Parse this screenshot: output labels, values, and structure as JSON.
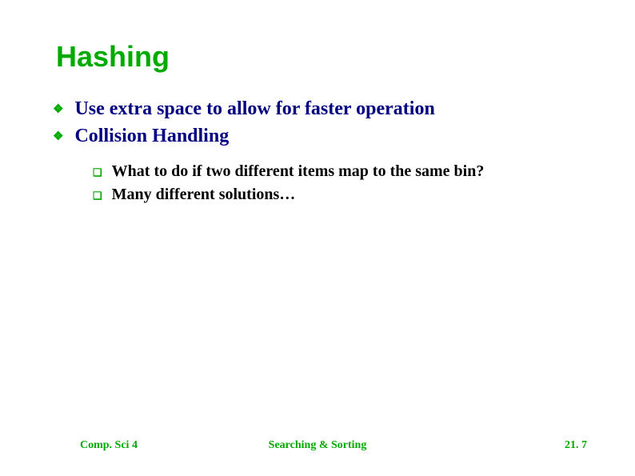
{
  "title": "Hashing",
  "bullets": [
    {
      "text": "Use extra space to allow for faster operation"
    },
    {
      "text": "Collision Handling"
    }
  ],
  "subbullets": [
    {
      "text": "What to do if two different items map to the same bin?"
    },
    {
      "text": "Many different solutions…"
    }
  ],
  "footer": {
    "left": "Comp. Sci 4",
    "center": "Searching & Sorting",
    "right": "21. 7"
  }
}
